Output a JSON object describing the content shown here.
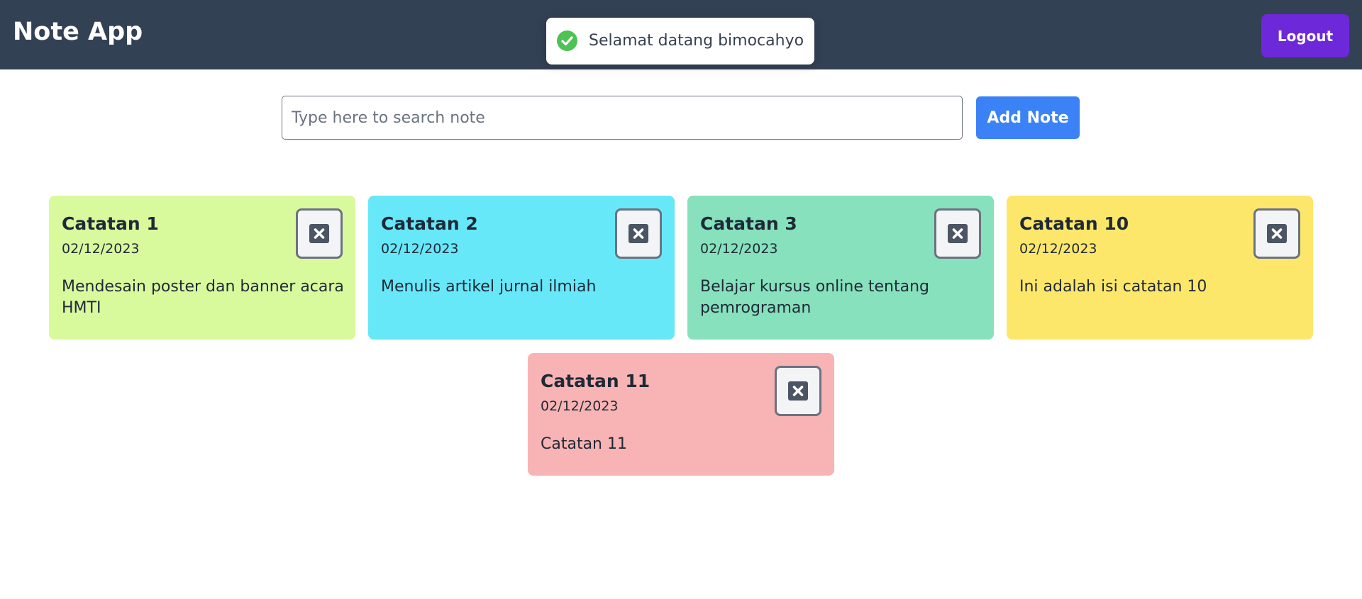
{
  "navbar": {
    "brand": "Note App",
    "logout_label": "Logout"
  },
  "toast": {
    "icon": "check-circle-icon",
    "message": "Selamat datang bimocahyo"
  },
  "search": {
    "placeholder": "Type here to search note",
    "value": ""
  },
  "add_note_label": "Add Note",
  "notes": [
    {
      "title": "Catatan 1",
      "date": "02/12/2023",
      "body": "Mendesain poster dan banner acara HMTI",
      "color": "#d9f99d"
    },
    {
      "title": "Catatan 2",
      "date": "02/12/2023",
      "body": "Menulis artikel jurnal ilmiah",
      "color": "#67e8f9"
    },
    {
      "title": "Catatan 3",
      "date": "02/12/2023",
      "body": "Belajar kursus online tentang pemrograman",
      "color": "#86e1bc"
    },
    {
      "title": "Catatan 10",
      "date": "02/12/2023",
      "body": "Ini adalah isi catatan 10",
      "color": "#fde76b"
    },
    {
      "title": "Catatan 11",
      "date": "02/12/2023",
      "body": "Catatan 11",
      "color": "#f8b3b4"
    }
  ],
  "colors": {
    "navbar": "#334155",
    "logout": "#6d28d9",
    "add_note": "#3b82f6",
    "toast_check": "#4fc254"
  }
}
